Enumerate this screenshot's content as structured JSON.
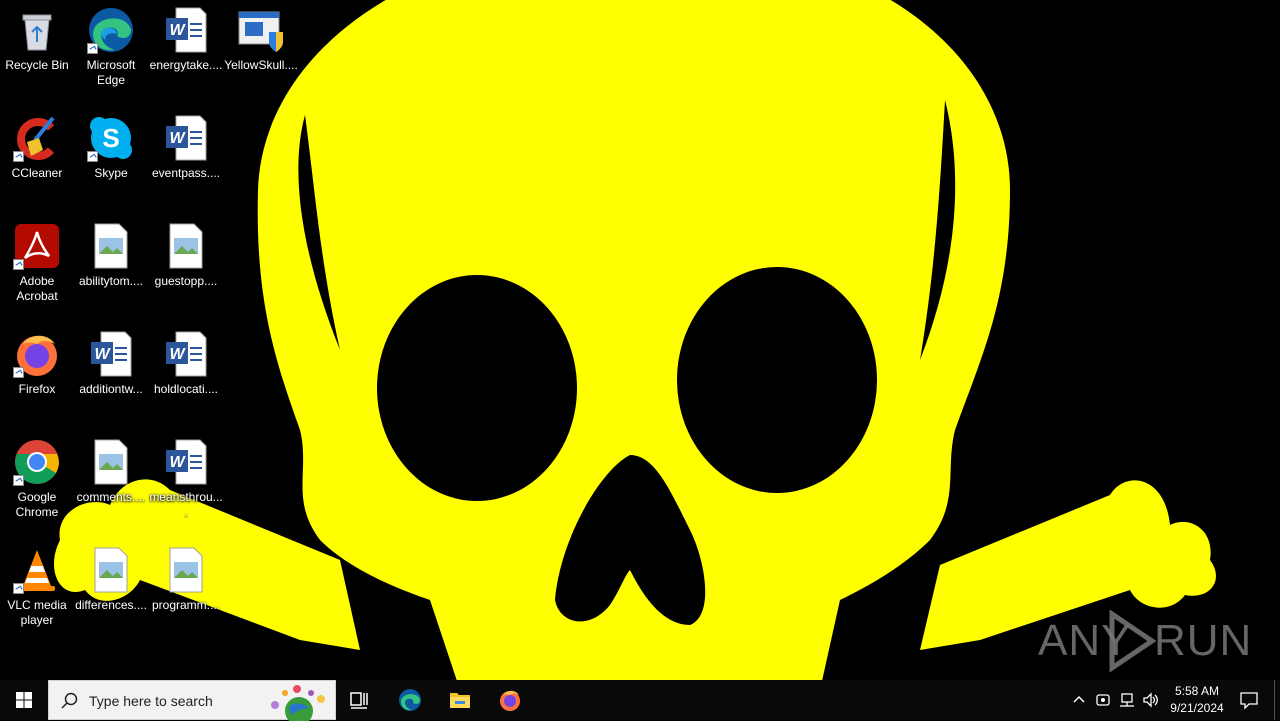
{
  "desktop": {
    "wallpaper": "yellow-skull-icon",
    "wallpaper_color": "#ffff00",
    "icons": [
      {
        "label": "Recycle Bin",
        "icon": "recycle-bin-icon"
      },
      {
        "label": "CCleaner",
        "icon": "ccleaner-icon"
      },
      {
        "label": "Adobe Acrobat",
        "icon": "adobe-acrobat-icon"
      },
      {
        "label": "Firefox",
        "icon": "firefox-icon"
      },
      {
        "label": "Google Chrome",
        "icon": "chrome-icon"
      },
      {
        "label": "VLC media player",
        "icon": "vlc-icon"
      },
      {
        "label": "Microsoft Edge",
        "icon": "edge-icon"
      },
      {
        "label": "Skype",
        "icon": "skype-icon"
      },
      {
        "label": "abilitytom....",
        "icon": "image-file-icon"
      },
      {
        "label": "additiontw...",
        "icon": "word-document-icon"
      },
      {
        "label": "comments....",
        "icon": "image-file-icon"
      },
      {
        "label": "differences....",
        "icon": "image-file-icon"
      },
      {
        "label": "energytake....",
        "icon": "word-document-icon"
      },
      {
        "label": "eventpass....",
        "icon": "word-document-icon"
      },
      {
        "label": "guestopp....",
        "icon": "image-file-icon"
      },
      {
        "label": "holdlocati....",
        "icon": "word-document-icon"
      },
      {
        "label": "meansthrou....",
        "icon": "word-document-icon"
      },
      {
        "label": "programm....",
        "icon": "image-file-icon"
      },
      {
        "label": "YellowSkull....",
        "icon": "exe-shield-icon"
      }
    ]
  },
  "watermark": {
    "left": "ANY",
    "right": "RUN",
    "icon": "play-triangle-icon"
  },
  "taskbar": {
    "start_icon": "windows-logo-icon",
    "search_placeholder": "Type here to search",
    "task_view_icon": "task-view-icon",
    "pinned": [
      "edge-icon",
      "file-explorer-icon",
      "firefox-icon"
    ],
    "tray_icons": [
      "chevron-up-icon",
      "meet-now-icon",
      "network-icon",
      "volume-icon"
    ],
    "time": "5:58 AM",
    "date": "9/21/2024",
    "notification_icon": "notification-icon"
  }
}
